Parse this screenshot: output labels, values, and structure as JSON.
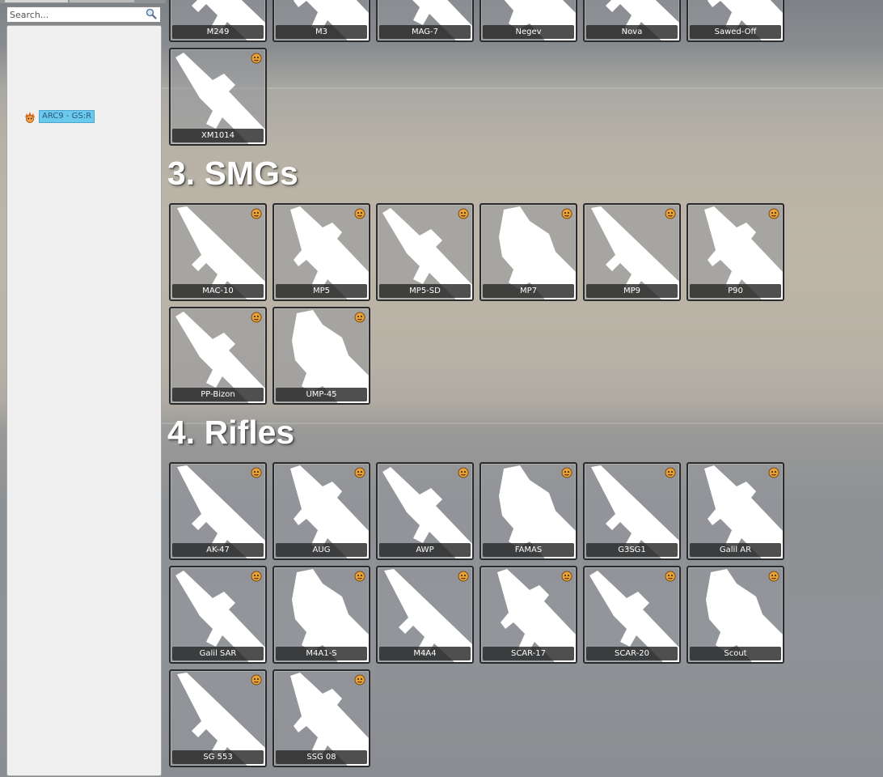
{
  "search": {
    "placeholder": "Search..."
  },
  "tree": {
    "node_label": "ARC9 - GS:R",
    "node_icon": "addon-icon"
  },
  "colors": {
    "tile_border": "#2b2b2b",
    "name_bar": "#282828",
    "tree_highlight": "#6cc9ee",
    "admin_icon": "#e8a23c"
  },
  "sections": [
    {
      "id": "prev",
      "title": "",
      "weapons": [
        {
          "name": "M249"
        },
        {
          "name": "M3"
        },
        {
          "name": "MAG-7"
        },
        {
          "name": "Negev"
        },
        {
          "name": "Nova"
        },
        {
          "name": "Sawed-Off"
        },
        {
          "name": "XM1014"
        }
      ]
    },
    {
      "id": "smgs",
      "title": "3. SMGs",
      "weapons": [
        {
          "name": "MAC-10"
        },
        {
          "name": "MP5"
        },
        {
          "name": "MP5-SD"
        },
        {
          "name": "MP7"
        },
        {
          "name": "MP9"
        },
        {
          "name": "P90"
        },
        {
          "name": "PP-Bizon"
        },
        {
          "name": "UMP-45"
        }
      ]
    },
    {
      "id": "rifles",
      "title": "4. Rifles",
      "weapons": [
        {
          "name": "AK-47"
        },
        {
          "name": "AUG"
        },
        {
          "name": "AWP"
        },
        {
          "name": "FAMAS"
        },
        {
          "name": "G3SG1"
        },
        {
          "name": "Galil AR"
        },
        {
          "name": "Galil SAR"
        },
        {
          "name": "M4A1-S"
        },
        {
          "name": "M4A4"
        },
        {
          "name": "SCAR-17"
        },
        {
          "name": "SCAR-20"
        },
        {
          "name": "Scout"
        },
        {
          "name": "SG 553"
        },
        {
          "name": "SSG 08"
        }
      ]
    }
  ]
}
